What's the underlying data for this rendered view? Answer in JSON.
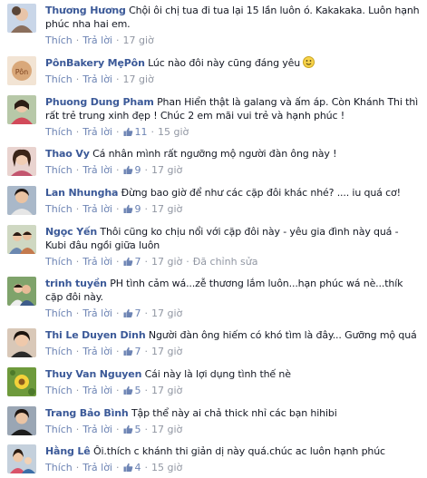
{
  "ui": {
    "like_label": "Thích",
    "reply_label": "Trả lời",
    "edited_label": "Đã chỉnh sửa"
  },
  "comments": [
    {
      "author": "Thương Hương",
      "text": "Chội ôi chị tua đi tua lại 15 lần luôn ó. Kakakaka. Luôn hạnh phúc nha hai em.",
      "likes": "",
      "time": "17 giờ",
      "avatar_icon": "avatar-photo"
    },
    {
      "author": "PônBakery MẹPôn",
      "text": "Lúc nào đôi này cũng đáng yêu",
      "emoji": "smiley-emoji-icon",
      "likes": "",
      "time": "17 giờ",
      "avatar_icon": "avatar-photo"
    },
    {
      "author": "Phuong Dung Pham",
      "text": "Phan Hiển thật là galang và ấm áp. Còn Khánh Thi thì rất trẻ trung xinh đẹp ! Chúc 2 em mãi vui trẻ và hạnh phúc !",
      "likes": "11",
      "time": "15 giờ",
      "avatar_icon": "avatar-photo"
    },
    {
      "author": "Thao Vy",
      "text": "Cá nhân mình rất ngưỡng mộ người đàn ông này !",
      "likes": "9",
      "time": "17 giờ",
      "avatar_icon": "avatar-photo"
    },
    {
      "author": "Lan Nhungha",
      "text": "Đừng bao giờ để như các cặp đôi khác nhé? .... iu quá cơ!",
      "likes": "9",
      "time": "17 giờ",
      "avatar_icon": "avatar-photo"
    },
    {
      "author": "Ngọc Yến",
      "text": "Thôi cũng ko chịu nổi với cặp đôi này - yêu gia đình này quá - Kubi đâu ngồi giữa luôn",
      "likes": "7",
      "time": "17 giờ",
      "edited": true,
      "avatar_icon": "avatar-photo"
    },
    {
      "author": "trinh tuyền",
      "text": "PH tình cảm wá...zễ thương lắm luôn...hạn phúc wá nè...thík cặp đôi này.",
      "likes": "7",
      "time": "17 giờ",
      "avatar_icon": "avatar-photo"
    },
    {
      "author": "Thi Le Duyen Dinh",
      "text": "Người đàn ông hiếm có khó tìm là đây... Gưỡng mộ quá",
      "likes": "7",
      "time": "17 giờ",
      "avatar_icon": "avatar-photo"
    },
    {
      "author": "Thuy Van Nguyen",
      "text": "Cái này là lợi dụng tình thế nè",
      "likes": "5",
      "time": "17 giờ",
      "avatar_icon": "avatar-photo"
    },
    {
      "author": "Trang Bảo Bình",
      "text": "Tập thể này ai chả thick nhỉ các bạn hihibi",
      "likes": "5",
      "time": "17 giờ",
      "avatar_icon": "avatar-photo"
    },
    {
      "author": "Hằng Lê",
      "text": "Ôi.thích c khánh thi giản dị này quá.chúc ac luôn hạnh phúc",
      "likes": "4",
      "time": "15 giờ",
      "avatar_icon": "avatar-photo"
    }
  ],
  "colors": {
    "author": "#3b5998",
    "link": "#6d84b4",
    "muted": "#9197a3"
  }
}
